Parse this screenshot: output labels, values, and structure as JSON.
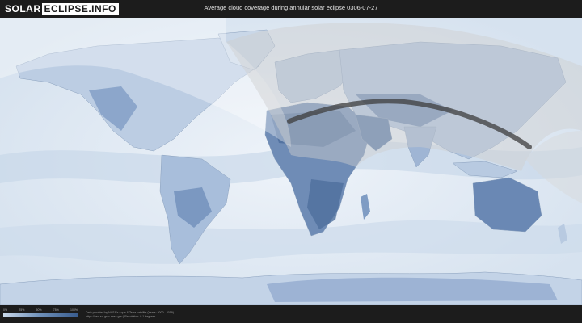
{
  "header": {
    "logo_left": "SOLAR",
    "logo_right": "ECLIPSE.INFO",
    "title": "Average cloud coverage during annular solar eclipse 0306-07-27"
  },
  "legend": {
    "ticks": [
      "0%",
      "25%",
      "50%",
      "75%",
      "100%"
    ],
    "colors": {
      "low": "#c9d8ea",
      "mid": "#6d8fb8",
      "high": "#3a5d8f"
    }
  },
  "credits": {
    "line1": "Data provided by NASA's Aqua & Terra satellite (Years: 2000 - 2019)",
    "line2": "https://neo.sci.gsfc.nasa.gov | Resolution: 0.1 degrees"
  },
  "colors": {
    "ocean": "#dfe8f2",
    "land_cloudy": "#a9bfdb",
    "land_clear": "#5f7fab",
    "eclipse_zone": "#c8c8c8",
    "path": "#404040"
  }
}
